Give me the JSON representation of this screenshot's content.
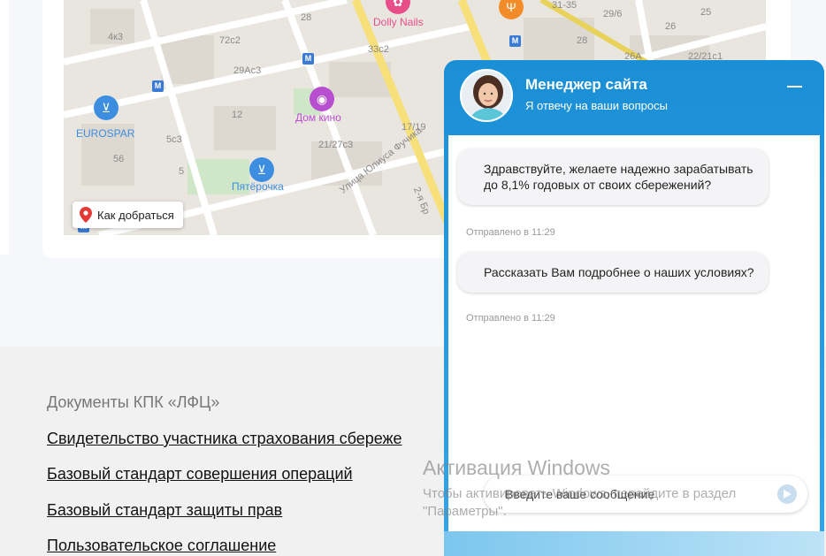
{
  "map": {
    "route_label": "Как добраться",
    "streets": [
      "Улица Юлиуса Фучика",
      "2-я Бр"
    ],
    "houses": [
      "4к3",
      "72с2",
      "28",
      "29Ас3",
      "33с2",
      "31-35",
      "29/6",
      "25",
      "26",
      "28",
      "26А",
      "22/21с1",
      "12",
      "17/19",
      "21/27с3",
      "5с3",
      "56",
      "5"
    ],
    "pois": [
      {
        "label": "Dolly Nails",
        "icon": "nails-icon",
        "color": "#e84f8a"
      },
      {
        "label": "Дом кино",
        "icon": "cinema-icon",
        "color": "#b84fd1"
      },
      {
        "label": "EUROSPAR",
        "icon": "basket-icon",
        "color": "#3d8ee0"
      },
      {
        "label": "Пятёрочка",
        "icon": "basket-icon",
        "color": "#3d8ee0"
      },
      {
        "label": "",
        "icon": "restaurant-icon",
        "color": "#f28c28"
      }
    ]
  },
  "documents": {
    "title": "Документы КПК «ЛФЦ»",
    "links": [
      "Свидетельство участника страхования сбереже",
      "Базовый стандарт совершения операций",
      "Базовый стандарт защиты прав",
      "Пользовательское соглашение"
    ]
  },
  "chat": {
    "manager_name": "Менеджер сайта",
    "subtitle": "Я отвечу на ваши вопросы",
    "messages": [
      {
        "text": "Здравствуйте, желаете надежно зарабатывать до 8,1% годовых от своих сбережений?",
        "time": "Отправлено в 11:29"
      },
      {
        "text": "Рассказать Вам подробнее о наших условиях?",
        "time": "Отправлено в 11:29"
      }
    ],
    "input_placeholder": "Введите ваше сообщение",
    "accent_color": "#1b8fd6"
  },
  "watermark": {
    "title": "Активация Windows",
    "text": "Чтобы активировать Windows, перейдите в раздел \"Параметры\"."
  }
}
